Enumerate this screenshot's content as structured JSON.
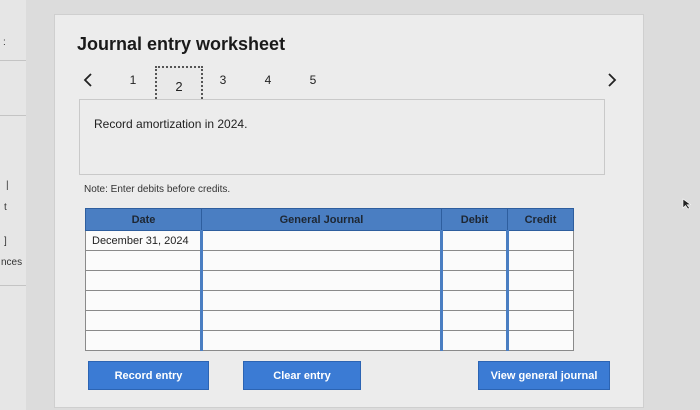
{
  "left_strip": {
    "fragments": [
      ":",
      "|",
      "t",
      "]",
      "nces"
    ]
  },
  "worksheet": {
    "title": "Journal entry worksheet",
    "pager": {
      "prev_icon": "chevron-left-icon",
      "next_icon": "chevron-right-icon",
      "pages": [
        "1",
        "2",
        "3",
        "4",
        "5"
      ],
      "current_page": "2"
    },
    "instruction": "Record amortization in 2024.",
    "note": "Note: Enter debits before credits.",
    "table": {
      "headers": [
        "Date",
        "General Journal",
        "Debit",
        "Credit"
      ],
      "rows": [
        {
          "date": "December 31, 2024",
          "account": "",
          "debit": "",
          "credit": ""
        },
        {
          "date": "",
          "account": "",
          "debit": "",
          "credit": ""
        },
        {
          "date": "",
          "account": "",
          "debit": "",
          "credit": ""
        },
        {
          "date": "",
          "account": "",
          "debit": "",
          "credit": ""
        },
        {
          "date": "",
          "account": "",
          "debit": "",
          "credit": ""
        },
        {
          "date": "",
          "account": "",
          "debit": "",
          "credit": ""
        }
      ]
    },
    "buttons": {
      "record": "Record entry",
      "clear": "Clear entry",
      "view": "View general journal"
    },
    "colors": {
      "accent": "#3b7bd4",
      "header": "#4a7ec2",
      "panel": "#ececec"
    }
  }
}
